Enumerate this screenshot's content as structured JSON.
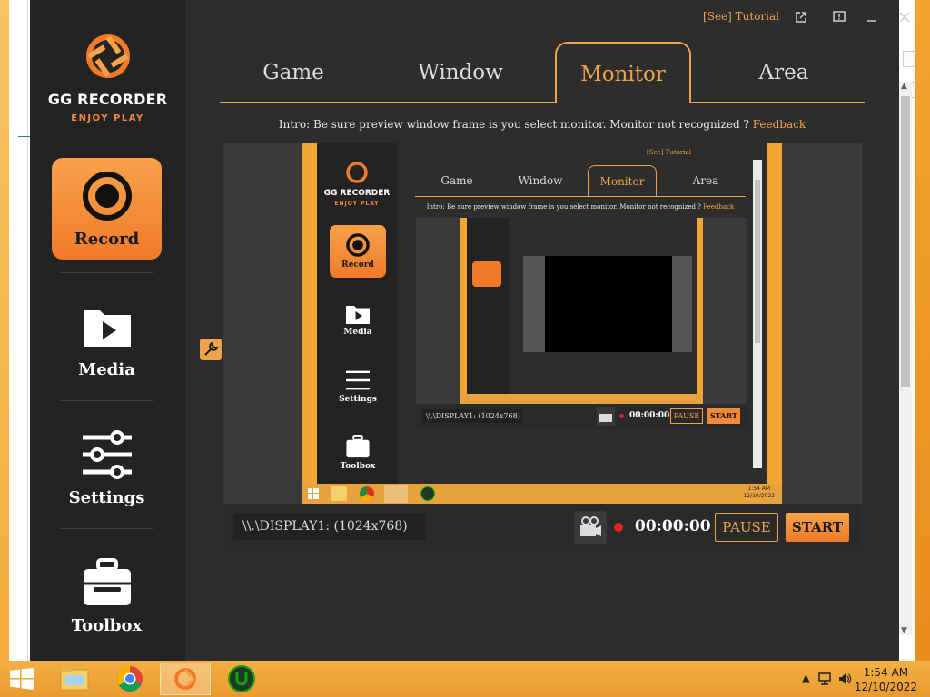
{
  "app": {
    "brand": "GG RECORDER",
    "tagline": "ENJOY PLAY",
    "tutorial_link": "[See] Tutorial",
    "nav": [
      {
        "label": "Record",
        "icon": "record-icon",
        "active": true
      },
      {
        "label": "Media",
        "icon": "folder-play-icon",
        "active": false
      },
      {
        "label": "Settings",
        "icon": "sliders-icon",
        "active": false
      },
      {
        "label": "Toolbox",
        "icon": "toolbox-icon",
        "active": false
      }
    ],
    "tabs": [
      {
        "label": "Game",
        "active": false
      },
      {
        "label": "Window",
        "active": false
      },
      {
        "label": "Monitor",
        "active": true
      },
      {
        "label": "Area",
        "active": false
      }
    ],
    "intro_text": "Intro: Be sure preview window frame is you select monitor. Monitor not recognized ?",
    "feedback_link": "Feedback",
    "display_value": "\\\\.\\DISPLAY1: (1024x768)",
    "timer": "00:00:00",
    "pause_label": "PAUSE",
    "start_label": "START"
  },
  "nested_preview": {
    "tutorial_link": "[See] Tutorial",
    "brand": "GG RECORDER",
    "tagline": "ENJOY PLAY",
    "nav": [
      "Record",
      "Media",
      "Settings",
      "Toolbox"
    ],
    "tabs": [
      "Game",
      "Window",
      "Monitor",
      "Area"
    ],
    "intro_text": "Intro: Be sure preview window frame is you select monitor. Monitor not recognized ?",
    "feedback_link": "Feedback",
    "display_value": "\\\\.\\DISPLAY1: (1024x768)",
    "timer": "00:00:00",
    "pause_label": "PAUSE",
    "start_label": "START",
    "clock_time": "1:54 AM",
    "clock_date": "12/10/2022"
  },
  "taskbar": {
    "items": [
      {
        "name": "file-explorer-icon"
      },
      {
        "name": "chrome-icon"
      },
      {
        "name": "gg-recorder-icon"
      },
      {
        "name": "upwork-icon"
      }
    ],
    "time": "1:54 AM",
    "date": "12/10/2022"
  },
  "colors": {
    "accent": "#f0a24a",
    "accent_dark": "#f07a2a",
    "app_bg": "#2d2d2d",
    "sidebar_bg": "#232323",
    "record_dot": "#e22222",
    "taskbar": "#f4b045"
  }
}
